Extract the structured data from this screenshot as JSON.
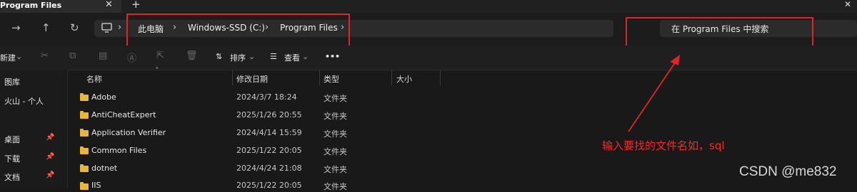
{
  "tab": {
    "title": "Program Files",
    "close": "✕",
    "new_tab": "+"
  },
  "window": {
    "minimize": "—",
    "maximize": "▢",
    "close": "✕"
  },
  "nav": {
    "back": "←",
    "forward": "→",
    "up": "↑",
    "refresh": "↻",
    "this_pc_icon": "monitor-icon"
  },
  "breadcrumb": [
    "此电脑",
    "Windows-SSD (C:)",
    "Program Files"
  ],
  "breadcrumb_separator": "›",
  "search": {
    "placeholder": "在 Program Files 中搜索"
  },
  "commandbar": {
    "new": "新建",
    "sort": "排序",
    "view": "查看",
    "more": "•••"
  },
  "sidebar": {
    "items": [
      {
        "label": "图库"
      },
      {
        "label": "火山 - 个人"
      },
      {
        "label": "桌面"
      },
      {
        "label": "下载"
      },
      {
        "label": "文档"
      }
    ]
  },
  "columns": {
    "name": "名称",
    "modified": "修改日期",
    "type": "类型",
    "size": "大小"
  },
  "rows": [
    {
      "name": "Adobe",
      "date": "2024/3/7 18:24",
      "type": "文件夹"
    },
    {
      "name": "AntiCheatExpert",
      "date": "2025/1/26 20:55",
      "type": "文件夹"
    },
    {
      "name": "Application Verifier",
      "date": "2024/4/14 15:59",
      "type": "文件夹"
    },
    {
      "name": "Common Files",
      "date": "2025/1/22 20:05",
      "type": "文件夹"
    },
    {
      "name": "dotnet",
      "date": "2024/4/24 21:08",
      "type": "文件夹"
    },
    {
      "name": "IIS",
      "date": "2025/1/22 20:05",
      "type": "文件夹"
    }
  ],
  "annotation": "输入要找的文件名如，sql",
  "watermark": "CSDN @me832",
  "colors": {
    "annotation": "#e02525",
    "folder": "#e8b73a",
    "background": "#191919"
  }
}
